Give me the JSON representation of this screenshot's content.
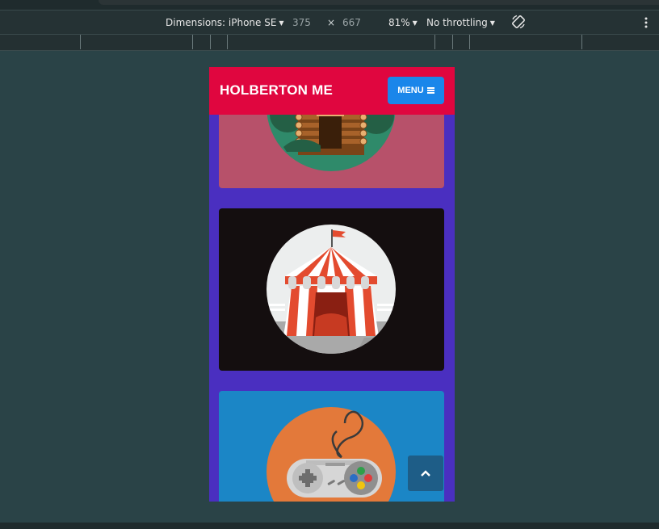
{
  "devtools": {
    "dimensions_label": "Dimensions: iPhone SE",
    "width": "375",
    "times": "×",
    "height": "667",
    "zoom": "81%",
    "throttling": "No throttling",
    "rotate_icon": "rotate-icon",
    "more_icon": "kebab-icon"
  },
  "site": {
    "brand": "HOLBERTON ME",
    "menu_label": "MENU",
    "scroll_top_icon": "chevron-up-icon"
  },
  "cards": [
    {
      "illustration": "log-cabin",
      "bg": "#b7516a"
    },
    {
      "illustration": "circus-tent",
      "bg": "#140e0f"
    },
    {
      "illustration": "snes-controller",
      "bg": "#1b86c6"
    }
  ],
  "colors": {
    "header": "#e0063f",
    "menu_button": "#1a86ea",
    "page_bg": "#4a2fc0",
    "scroll_top": "#1e5d87"
  }
}
